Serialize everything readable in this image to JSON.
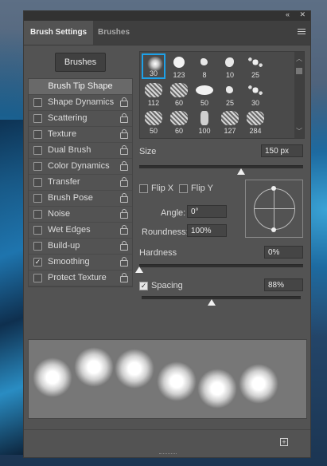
{
  "panel": {
    "collapse_icon": "«",
    "close_icon": "✕",
    "tabs": [
      {
        "label": "Brush Settings",
        "active": true
      },
      {
        "label": "Brushes",
        "active": false
      }
    ],
    "menu_icon": "hamburger-menu-icon"
  },
  "brushes_button": "Brushes",
  "options": [
    {
      "label": "Brush Tip Shape",
      "checked": null,
      "selected": true
    },
    {
      "label": "Shape Dynamics",
      "checked": false
    },
    {
      "label": "Scattering",
      "checked": false
    },
    {
      "label": "Texture",
      "checked": false
    },
    {
      "label": "Dual Brush",
      "checked": false
    },
    {
      "label": "Color Dynamics",
      "checked": false
    },
    {
      "label": "Transfer",
      "checked": false
    },
    {
      "label": "Brush Pose",
      "checked": false
    },
    {
      "label": "Noise",
      "checked": false
    },
    {
      "label": "Wet Edges",
      "checked": false
    },
    {
      "label": "Build-up",
      "checked": false
    },
    {
      "label": "Smoothing",
      "checked": true
    },
    {
      "label": "Protect Texture",
      "checked": false
    }
  ],
  "brush_presets": [
    {
      "size": "30",
      "kind": "soft",
      "selected": true
    },
    {
      "size": "123",
      "kind": "hard"
    },
    {
      "size": "8",
      "kind": "splat"
    },
    {
      "size": "10",
      "kind": "blob"
    },
    {
      "size": "25",
      "kind": "splatter"
    },
    {
      "size": "112",
      "kind": "texture"
    },
    {
      "size": "60",
      "kind": "texture"
    },
    {
      "size": "50",
      "kind": "hard-oval"
    },
    {
      "size": "25",
      "kind": "splat"
    },
    {
      "size": "30",
      "kind": "splatter"
    },
    {
      "size": "50",
      "kind": "texture"
    },
    {
      "size": "60",
      "kind": "texture"
    },
    {
      "size": "100",
      "kind": "stroke"
    },
    {
      "size": "127",
      "kind": "texture"
    },
    {
      "size": "284",
      "kind": "texture"
    }
  ],
  "size": {
    "label": "Size",
    "value": "150 px",
    "slider_fraction": 0.62
  },
  "flip_x": {
    "label": "Flip X",
    "checked": false
  },
  "flip_y": {
    "label": "Flip Y",
    "checked": false
  },
  "angle": {
    "label": "Angle:",
    "value": "0°"
  },
  "roundness": {
    "label": "Roundness:",
    "value": "100%"
  },
  "hardness": {
    "label": "Hardness",
    "value": "0%",
    "slider_fraction": 0.0
  },
  "spacing": {
    "label": "Spacing",
    "value": "88%",
    "checked": true,
    "slider_fraction": 0.44
  },
  "new_brush_icon": "+"
}
